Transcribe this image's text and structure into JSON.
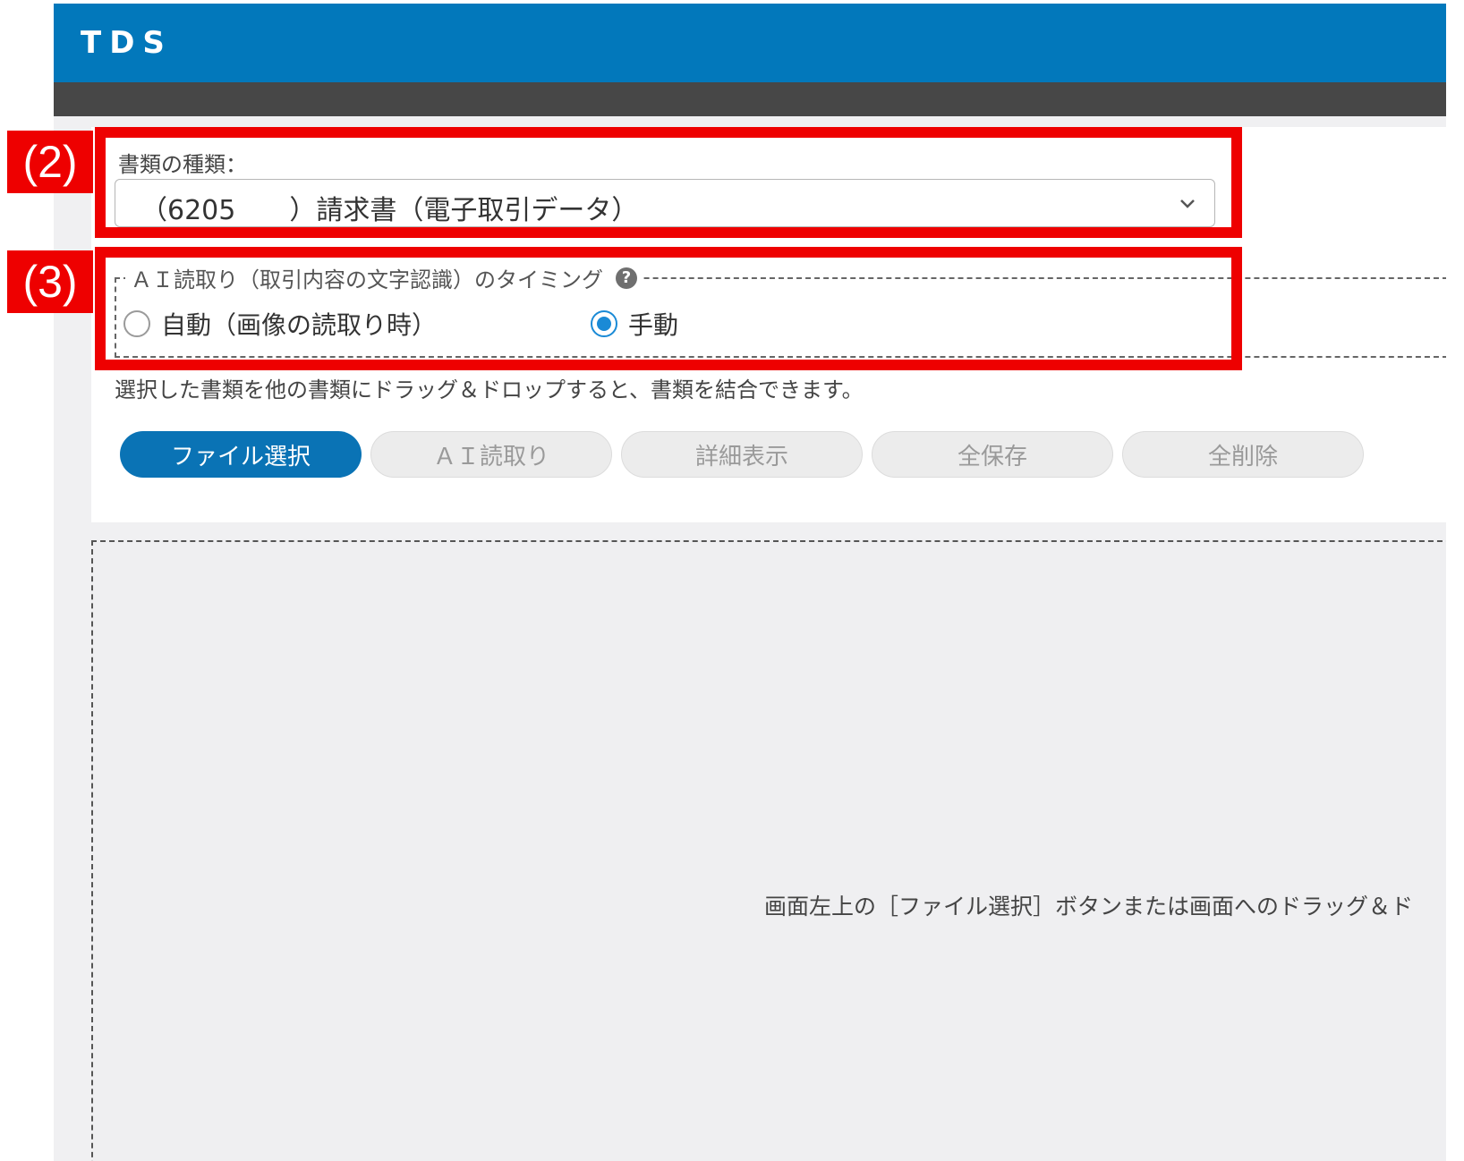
{
  "app": {
    "title": "TDS"
  },
  "document_type": {
    "label": "書類の種類：",
    "selected_value": "（6205　　）請求書（電子取引データ）"
  },
  "ai_timing": {
    "legend": "ＡＩ読取り（取引内容の文字認識）のタイミング",
    "help_icon": "?",
    "options": [
      {
        "label": "自動（画像の読取り時）",
        "checked": false
      },
      {
        "label": "手動",
        "checked": true
      }
    ]
  },
  "hint": "選択した書類を他の書類にドラッグ＆ドロップすると、書類を結合できます。",
  "toolbar": {
    "buttons": [
      {
        "label": "ファイル選択",
        "state": "primary"
      },
      {
        "label": "ＡＩ読取り",
        "state": "disabled"
      },
      {
        "label": "詳細表示",
        "state": "disabled"
      },
      {
        "label": "全保存",
        "state": "disabled"
      },
      {
        "label": "全削除",
        "state": "disabled"
      }
    ]
  },
  "drop_zone": {
    "hint": "画面左上の［ファイル選択］ボタンまたは画面へのドラッグ＆ド"
  },
  "annotations": [
    {
      "tag": "(2)"
    },
    {
      "tag": "(3)"
    }
  ],
  "colors": {
    "header": "#0278bb",
    "subbar": "#474747",
    "primary_button": "#0a73b5",
    "radio_checked": "#1a8ad6",
    "annotation": "#ee0000"
  }
}
